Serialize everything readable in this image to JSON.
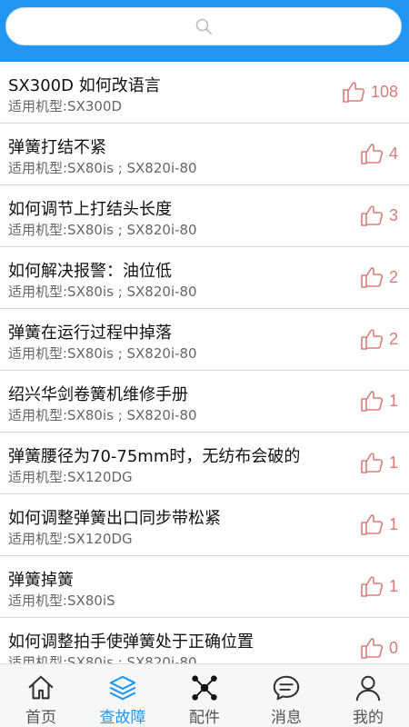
{
  "search": {
    "placeholder": ""
  },
  "rows": [
    {
      "title": "SX300D 如何改语言",
      "subtitle": "适用机型:SX300D",
      "likes": "108"
    },
    {
      "title": "弹簧打结不紧",
      "subtitle": "适用机型:SX80is ; SX820i-80",
      "likes": "4"
    },
    {
      "title": "如何调节上打结头长度",
      "subtitle": "适用机型:SX80is ; SX820i-80",
      "likes": "3"
    },
    {
      "title": "如何解决报警：油位低",
      "subtitle": "适用机型:SX80is ; SX820i-80",
      "likes": "2"
    },
    {
      "title": "弹簧在运行过程中掉落",
      "subtitle": "适用机型:SX80is ; SX820i-80",
      "likes": "2"
    },
    {
      "title": "绍兴华剑卷簧机维修手册",
      "subtitle": "适用机型:SX80is ; SX820i-80",
      "likes": "1"
    },
    {
      "title": "弹簧腰径为70-75mm时，无纺布会破的",
      "subtitle": "适用机型:SX120DG",
      "likes": "1"
    },
    {
      "title": "如何调整弹簧出口同步带松紧",
      "subtitle": "适用机型:SX120DG",
      "likes": "1"
    },
    {
      "title": "弹簧掉簧",
      "subtitle": "适用机型:SX80iS",
      "likes": "1"
    },
    {
      "title": "如何调整拍手使弹簧处于正确位置",
      "subtitle": "适用机型:SX80is ; SX820i-80",
      "likes": "0"
    }
  ],
  "tabs": [
    {
      "label": "首页",
      "icon": "home-icon",
      "active": false
    },
    {
      "label": "查故障",
      "icon": "layers-icon",
      "active": true
    },
    {
      "label": "配件",
      "icon": "nodes-icon",
      "active": false
    },
    {
      "label": "消息",
      "icon": "chat-icon",
      "active": false
    },
    {
      "label": "我的",
      "icon": "user-icon",
      "active": false
    }
  ],
  "colors": {
    "header": "#2196f3",
    "like": "#e07a78",
    "tab_active": "#2196f3",
    "tab_inactive": "#555555"
  }
}
